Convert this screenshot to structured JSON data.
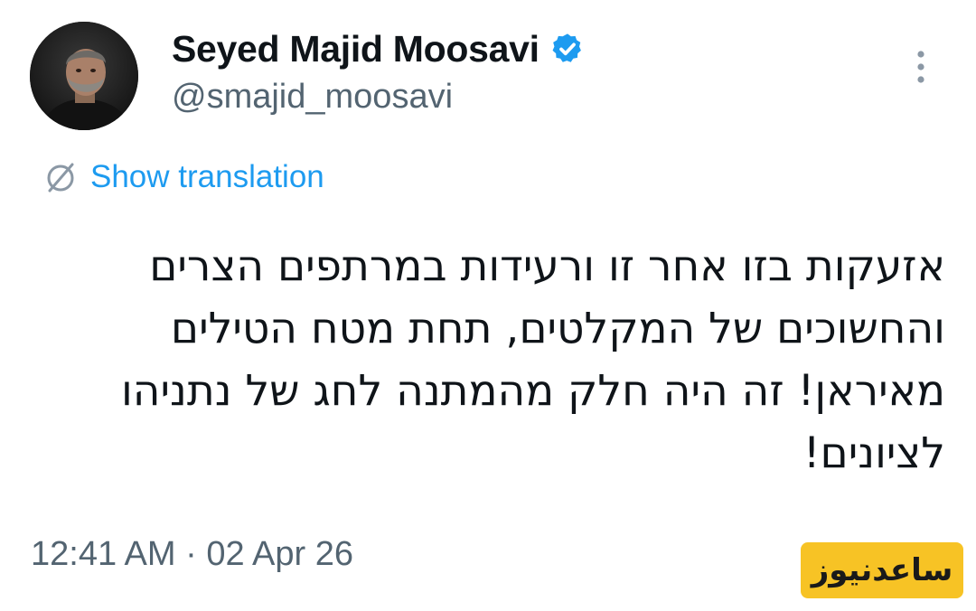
{
  "user": {
    "display_name": "Seyed Majid Moosavi",
    "handle": "@smajid_moosavi",
    "verified": true,
    "verified_badge_color": "#1d9bf0"
  },
  "icons": {
    "avatar": "avatar-photo",
    "verified": "verified-badge-icon",
    "more": "more-options-icon",
    "translate": "translate-globe-icon"
  },
  "translation": {
    "label": "Show translation",
    "color": "#1d9bf0"
  },
  "tweet": {
    "lines": [
      "אזעקות בזו אחר זו ורעידות במרתפים הצרים",
      "והחשוכים של המקלטים, תחת מטח הטילים",
      "מאיראן! זה היה חלק מהמתנה לחג של נתניהו",
      "לציונים!"
    ]
  },
  "meta": {
    "timestamp": "12:41 AM · 02 Apr 26"
  },
  "watermark": {
    "text": "ساعدنیوز",
    "background": "#f7c325"
  }
}
